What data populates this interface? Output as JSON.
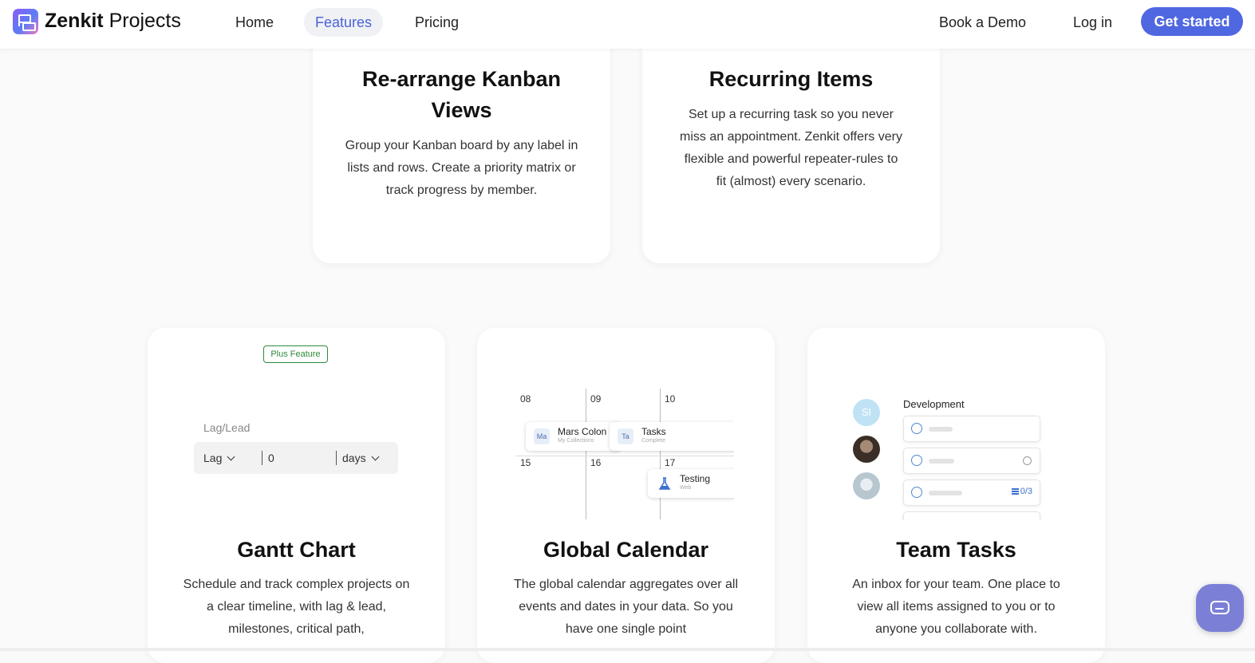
{
  "nav": {
    "brand_bold": "Zenkit",
    "brand_rest": " Projects",
    "links": [
      "Home",
      "Features",
      "Pricing"
    ],
    "active": "Features",
    "book_demo": "Book a Demo",
    "login": "Log in",
    "get_started": "Get started"
  },
  "cards": [
    {
      "title": "Re-arrange Kanban Views",
      "text": "Group your Kanban board by any label in lists and rows. Create a priority matrix or track progress by member."
    },
    {
      "title": "Recurring Items",
      "text": "Set up a recurring task so you never miss an appointment. Zenkit offers very flexible and powerful repeater-rules to fit (almost) every scenario."
    },
    {
      "title": "Gantt Chart",
      "text": "Schedule and track complex projects on a clear timeline, with lag & lead, milestones, critical path,",
      "illustration": {
        "badge": "Plus Feature",
        "label": "Lag/Lead",
        "type_value": "Lag",
        "amount_value": "0",
        "unit_value": "days"
      }
    },
    {
      "title": "Global Calendar",
      "text": "The global calendar aggregates over all events and dates in your data. So you have one single point",
      "illustration": {
        "dates_top": [
          "08",
          "09",
          "10"
        ],
        "dates_bottom": [
          "15",
          "16",
          "17"
        ],
        "events": [
          {
            "icon": "Ma",
            "title": "Mars Colon",
            "sub": "My Collections"
          },
          {
            "icon": "Ta",
            "title": "Tasks",
            "sub": "Complete"
          },
          {
            "icon": "flask-icon",
            "title": "Testing",
            "sub": "Web"
          }
        ]
      }
    },
    {
      "title": "Team Tasks",
      "text": "An inbox for your team. One place to view all items assigned to you or to anyone you collaborate with.",
      "illustration": {
        "avatar_initials": "SI",
        "group": "Development",
        "subtask_count": "0/3"
      }
    }
  ],
  "colors": {
    "accent": "#4f67e0",
    "active_link": "#4a63d9",
    "plus_badge": "#2e8b3a",
    "chat": "#7c7fd6"
  }
}
